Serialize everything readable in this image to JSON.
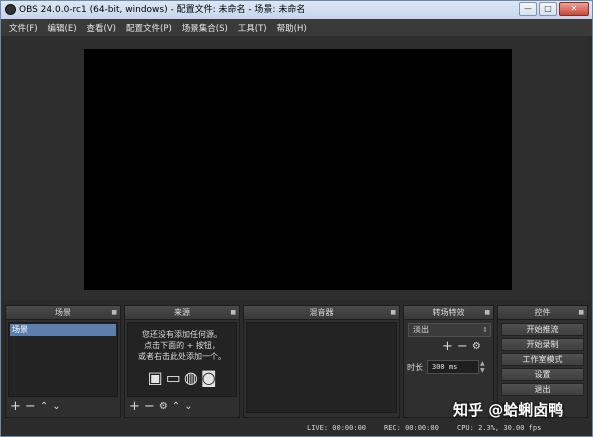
{
  "window": {
    "title": "OBS 24.0.0-rc1 (64-bit, windows) - 配置文件: 未命名 - 场景: 未命名",
    "buttons": {
      "minimize": "—",
      "maximize": "□",
      "close": "✕"
    }
  },
  "menubar": {
    "items": [
      "文件(F)",
      "编辑(E)",
      "查看(V)",
      "配置文件(P)",
      "场景集合(S)",
      "工具(T)",
      "帮助(H)"
    ]
  },
  "docks": {
    "scenes": {
      "title": "场景",
      "items": [
        "场景"
      ]
    },
    "sources": {
      "title": "来源",
      "hint_lines": [
        "您还没有添加任何源。",
        "点击下面的 + 按钮，",
        "或者右击此处添加一个。"
      ]
    },
    "mixer": {
      "title": "混音器"
    },
    "transitions": {
      "title": "转场特效",
      "selected": "淡出",
      "duration_label": "时长",
      "duration_value": "300 ms"
    },
    "controls": {
      "title": "控件",
      "buttons": [
        "开始推流",
        "开始录制",
        "工作室模式",
        "设置",
        "退出"
      ]
    }
  },
  "status": {
    "live": "LIVE: 00:00:00",
    "rec": "REC: 00:00:00",
    "cpu": "CPU: 2.3%, 30.00 fps"
  },
  "watermark": "知乎 @蛤蜊卤鸭"
}
